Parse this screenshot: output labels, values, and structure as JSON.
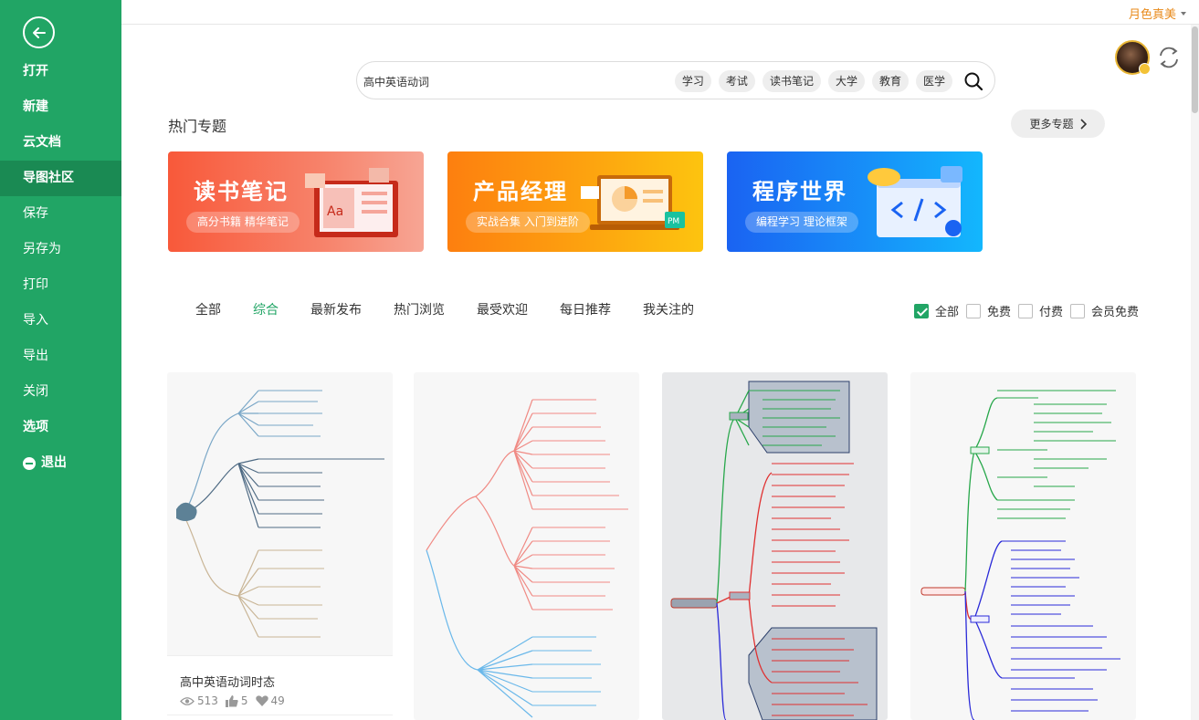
{
  "sidebar": {
    "menu": [
      {
        "label": "打开",
        "bold": true
      },
      {
        "label": "新建",
        "bold": true
      },
      {
        "label": "云文档",
        "bold": true
      },
      {
        "label": "导图社区",
        "bold": true,
        "active": true
      },
      {
        "label": "保存",
        "bold": false
      },
      {
        "label": "另存为",
        "bold": false
      },
      {
        "label": "打印",
        "bold": false
      },
      {
        "label": "导入",
        "bold": false
      },
      {
        "label": "导出",
        "bold": false
      },
      {
        "label": "关闭",
        "bold": false
      },
      {
        "label": "选项",
        "bold": true
      }
    ],
    "exit_label": "退出"
  },
  "header": {
    "username": "月色真美"
  },
  "search": {
    "value": "高中英语动词",
    "tags": [
      "学习",
      "考试",
      "读书笔记",
      "大学",
      "教育",
      "医学"
    ]
  },
  "hot": {
    "title": "热门专题",
    "more_label": "更多专题",
    "banners": [
      {
        "title": "读书笔记",
        "subtitle": "高分书籍 精华笔记"
      },
      {
        "title": "产品经理",
        "subtitle": "实战合集 入门到进阶"
      },
      {
        "title": "程序世界",
        "subtitle": "编程学习 理论框架"
      }
    ]
  },
  "tabs": [
    "全部",
    "综合",
    "最新发布",
    "热门浏览",
    "最受欢迎",
    "每日推荐",
    "我关注的"
  ],
  "active_tab": "综合",
  "filters": [
    {
      "label": "全部",
      "checked": true
    },
    {
      "label": "免费",
      "checked": false
    },
    {
      "label": "付费",
      "checked": false
    },
    {
      "label": "会员免费",
      "checked": false
    }
  ],
  "cards": [
    {
      "title": "高中英语动词时态",
      "views": "513",
      "likes": "5",
      "favorites": "49"
    }
  ],
  "colors": {
    "brand_green": "#21a565",
    "username_orange": "#e88a1a"
  },
  "icons": [
    "back-arrow-icon",
    "search-icon",
    "chevron-right-icon",
    "refresh-icon",
    "eye-icon",
    "thumbs-up-icon",
    "heart-icon"
  ]
}
